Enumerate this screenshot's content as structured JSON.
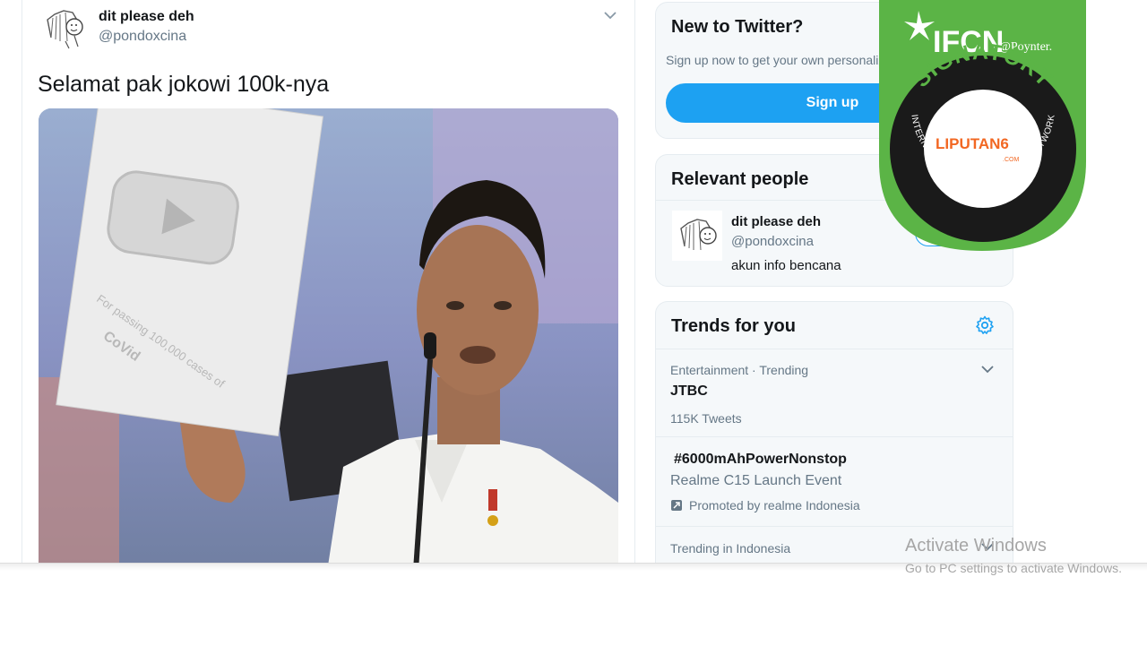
{
  "tweet": {
    "author_name": "dit please deh",
    "author_handle": "@pondoxcina",
    "text": "Selamat pak jokowi 100k-nya",
    "media_plaque_lines": [
      "For passing 100,000 cases of",
      "CoVid"
    ]
  },
  "new_to_twitter": {
    "title": "New to Twitter?",
    "subtitle": "Sign up now to get your own personalized timeline!",
    "signup_label": "Sign up"
  },
  "relevant_people": {
    "title": "Relevant people",
    "person": {
      "name": "dit please deh",
      "handle": "@pondoxcina",
      "bio": "akun info bencana"
    }
  },
  "trends": {
    "title": "Trends for you",
    "items": [
      {
        "meta": "Entertainment · Trending",
        "name": "JTBC",
        "count": "115K Tweets"
      },
      {
        "meta": "",
        "name": "#6000mAhPowerNonstop",
        "sub": "Realme C15 Launch Event",
        "promoted": "Promoted by realme Indonesia"
      },
      {
        "meta": "Trending in Indonesia",
        "name": ""
      }
    ]
  },
  "badge": {
    "brand": "IFCN",
    "by": "@Poynter.",
    "ring_top": "SIGNATORY",
    "ring_bottom": "INTERNATIONAL FACT-CHECKING NETWORK",
    "center_logo": "LIPUTAN6",
    "center_sub": ".COM"
  },
  "windows_notice": {
    "title": "Activate Windows",
    "subtitle": "Go to PC settings to activate Windows."
  },
  "colors": {
    "accent": "#1da1f2",
    "badge_green": "#5bb446",
    "badge_dark": "#1a1a1a",
    "liputan_orange": "#f26722"
  },
  "icons": [
    "chevron-down-icon",
    "gear-icon",
    "promoted-icon"
  ]
}
